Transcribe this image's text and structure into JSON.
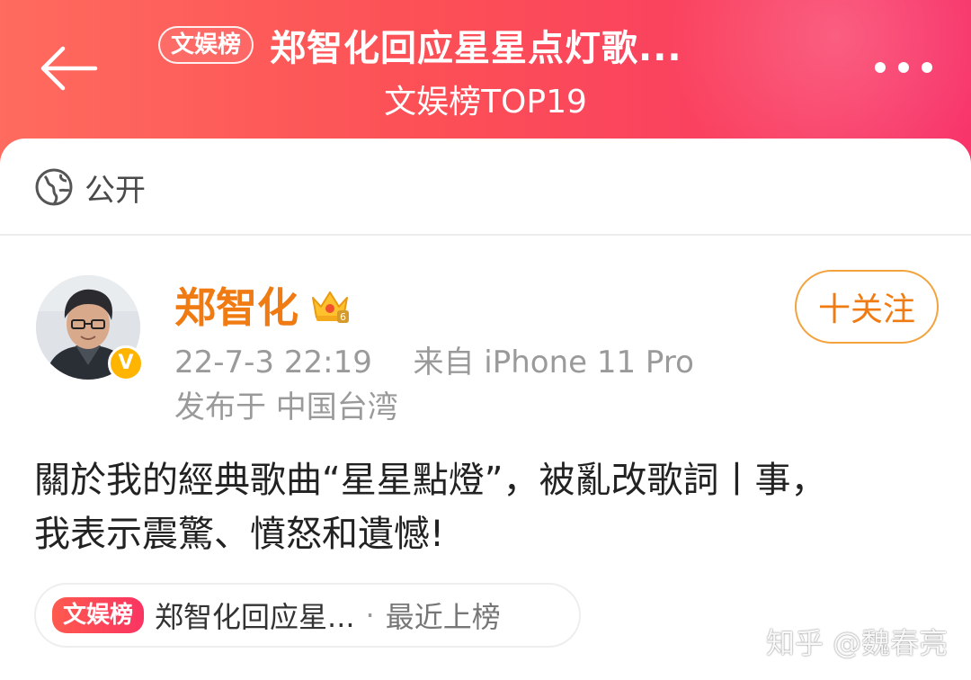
{
  "header": {
    "tag": "文娱榜",
    "title": "郑智化回应星星点灯歌...",
    "subtitle": "文娱榜TOP19",
    "back_icon": "arrow-left-icon",
    "more_icon": "more-dots-icon"
  },
  "visibility": {
    "icon": "globe-icon",
    "label": "公开"
  },
  "post": {
    "user_name": "郑智化",
    "verified_badge": "V",
    "crown_icon": "crown-icon",
    "crown_level": "6",
    "timestamp": "22-7-3 22:19",
    "source": "来自 iPhone 11 Pro",
    "location": "发布于 中国台湾",
    "follow_label": "十关注",
    "text_line1": "關於我的經典歌曲“星星點燈”，被亂改歌詞丨事，",
    "text_line2": "我表示震驚、憤怒和遺憾!"
  },
  "trend": {
    "tag": "文娱榜",
    "title": "郑智化回应星...",
    "separator": "·",
    "status": "最近上榜"
  },
  "watermark": "知乎 @魏春亮",
  "colors": {
    "header_start": "#ff6b5e",
    "header_end": "#f8346a",
    "name_orange": "#f07b12",
    "follow_border": "#f3a33e"
  }
}
